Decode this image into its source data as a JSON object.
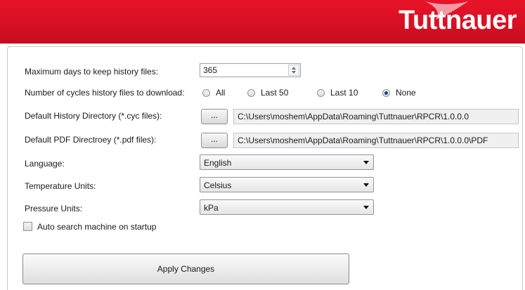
{
  "brand": {
    "logo_text": "Tuttnauer",
    "color": "#e2122a"
  },
  "settings": {
    "max_days_label": "Maximum days to keep history files:",
    "max_days_value": "365",
    "cycles_label": "Number of cycles history files to download:",
    "cycles_options": [
      {
        "label": "All",
        "checked": false
      },
      {
        "label": "Last 50",
        "checked": false
      },
      {
        "label": "Last 10",
        "checked": false
      },
      {
        "label": "None",
        "checked": true
      }
    ],
    "history_dir_label": "Default History Directory (*.cyc files):",
    "history_dir_button": "...",
    "history_dir_value": "C:\\Users\\moshem\\AppData\\Roaming\\Tuttnauer\\RPCR\\1.0.0.0",
    "pdf_dir_label": "Default PDF Directroey (*.pdf files):",
    "pdf_dir_button": "...",
    "pdf_dir_value": "C:\\Users\\moshem\\AppData\\Roaming\\Tuttnauer\\RPCR\\1.0.0.0\\PDF",
    "language_label": "Language:",
    "language_value": "English",
    "temperature_label": "Temperature Units:",
    "temperature_value": "Celsius",
    "pressure_label": "Pressure Units:",
    "pressure_value": "kPa",
    "auto_search_label": "Auto search machine on startup",
    "auto_search_checked": false,
    "apply_label": "Apply Changes"
  }
}
